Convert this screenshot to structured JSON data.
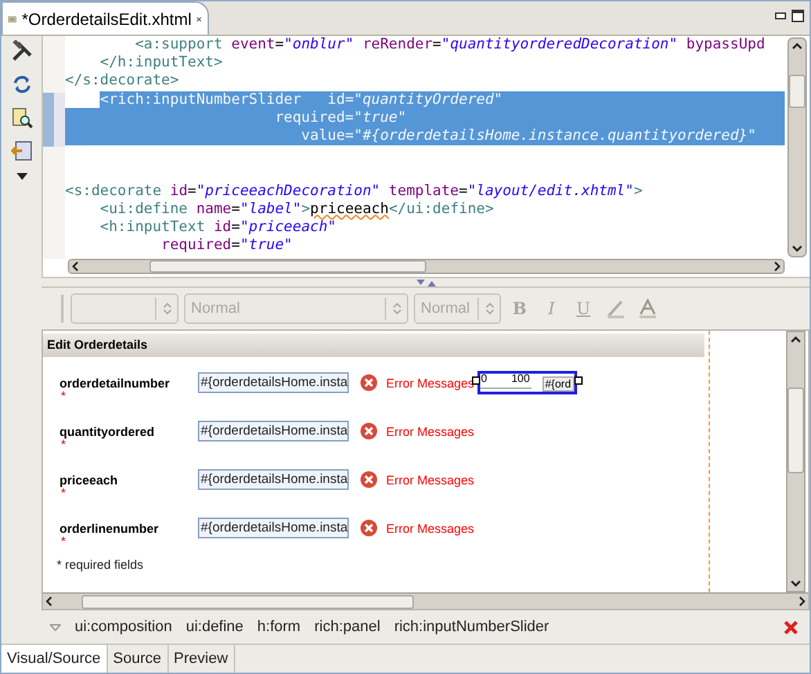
{
  "editor_tab": {
    "title": "*OrderdetailsEdit.xhtml"
  },
  "source": {
    "lines": [
      {
        "kind": "code",
        "selected": false,
        "tokens": [
          {
            "kind": "tag",
            "text": "        <a:support"
          },
          {
            "kind": "attr",
            "text": " event"
          },
          {
            "kind": "eq",
            "text": "="
          },
          {
            "kind": "value",
            "text": "\"onblur\""
          },
          {
            "kind": "attr",
            "text": " reRender"
          },
          {
            "kind": "eq",
            "text": "="
          },
          {
            "kind": "value",
            "text": "\"quantityorderedDecoration\""
          },
          {
            "kind": "attr",
            "text": " bypassUpd"
          }
        ]
      },
      {
        "kind": "code",
        "selected": false,
        "tokens": [
          {
            "kind": "tag",
            "text": "    </h:inputText>"
          }
        ]
      },
      {
        "kind": "code",
        "selected": false,
        "tokens": [
          {
            "kind": "tag",
            "text": "</s:decorate>"
          }
        ]
      },
      {
        "kind": "code",
        "selected": true,
        "tokens": [
          {
            "kind": "tag",
            "text": "    <rich:inputNumberSlider"
          },
          {
            "kind": "attr",
            "text": "   id"
          },
          {
            "kind": "eq",
            "text": "="
          },
          {
            "kind": "value",
            "text": "\"quantityOrdered\""
          }
        ]
      },
      {
        "kind": "code",
        "selected": true,
        "tokens": [
          {
            "kind": "attr",
            "text": "                        required"
          },
          {
            "kind": "eq",
            "text": "="
          },
          {
            "kind": "value",
            "text": "\"true\""
          }
        ]
      },
      {
        "kind": "code",
        "selected": true,
        "tokens": [
          {
            "kind": "attr",
            "text": "                           value"
          },
          {
            "kind": "eq",
            "text": "="
          },
          {
            "kind": "value",
            "text": "\"#{orderdetailsHome.instance.quantityordered}\""
          }
        ]
      },
      {
        "kind": "blank"
      },
      {
        "kind": "blank"
      },
      {
        "kind": "code",
        "selected": false,
        "tokens": [
          {
            "kind": "tag",
            "text": "<s:decorate"
          },
          {
            "kind": "attr",
            "text": " id"
          },
          {
            "kind": "eq",
            "text": "="
          },
          {
            "kind": "value",
            "text": "\"priceeachDecoration\""
          },
          {
            "kind": "attr",
            "text": " template"
          },
          {
            "kind": "eq",
            "text": "="
          },
          {
            "kind": "value",
            "text": "\"layout/edit.xhtml\""
          },
          {
            "kind": "tag",
            "text": ">"
          }
        ]
      },
      {
        "kind": "code",
        "selected": false,
        "tokens": [
          {
            "kind": "tag",
            "text": "    <ui:define"
          },
          {
            "kind": "attr",
            "text": " name"
          },
          {
            "kind": "eq",
            "text": "="
          },
          {
            "kind": "value",
            "text": "\"label\""
          },
          {
            "kind": "tag",
            "text": ">"
          },
          {
            "kind": "misspelled",
            "text": "priceeach"
          },
          {
            "kind": "tag",
            "text": "</ui:define>"
          }
        ]
      },
      {
        "kind": "code",
        "selected": false,
        "tokens": [
          {
            "kind": "tag",
            "text": "    <h:inputText"
          },
          {
            "kind": "attr",
            "text": " id"
          },
          {
            "kind": "eq",
            "text": "="
          },
          {
            "kind": "value",
            "text": "\"priceeach\""
          }
        ]
      },
      {
        "kind": "code",
        "selected": false,
        "tokens": [
          {
            "kind": "attr",
            "text": "           required"
          },
          {
            "kind": "eq",
            "text": "="
          },
          {
            "kind": "value",
            "text": "\"true\""
          }
        ]
      }
    ]
  },
  "format_toolbar": {
    "combos": [
      {
        "disabled": true
      },
      {
        "value": "Normal",
        "disabled": true
      },
      {
        "value": "Normal",
        "disabled": true
      }
    ],
    "buttons": [
      "B",
      "I",
      "U"
    ]
  },
  "visual": {
    "panel_title": "Edit Orderdetails",
    "fields": [
      {
        "label": "orderdetailnumber",
        "required_mark": "*",
        "value": "#{orderdetailsHome.insta",
        "error": "Error Messages",
        "slider": {
          "selected": true,
          "min": "0",
          "max": "100",
          "value": "#{ord"
        }
      },
      {
        "label": "quantityordered",
        "required_mark": "*",
        "value": "#{orderdetailsHome.insta",
        "error": "Error Messages"
      },
      {
        "label": "priceeach",
        "required_mark": "*",
        "value": "#{orderdetailsHome.insta",
        "error": "Error Messages"
      },
      {
        "label": "orderlinenumber",
        "required_mark": "*",
        "value": "#{orderdetailsHome.insta",
        "error": "Error Messages"
      }
    ],
    "footnote": "* required fields"
  },
  "breadcrumb": [
    "ui:composition",
    "ui:define",
    "h:form",
    "rich:panel",
    "rich:inputNumberSlider"
  ],
  "bottom_tabs": [
    {
      "label": "Visual/Source",
      "selected": true
    },
    {
      "label": "Source",
      "selected": false
    },
    {
      "label": "Preview",
      "selected": false
    }
  ]
}
